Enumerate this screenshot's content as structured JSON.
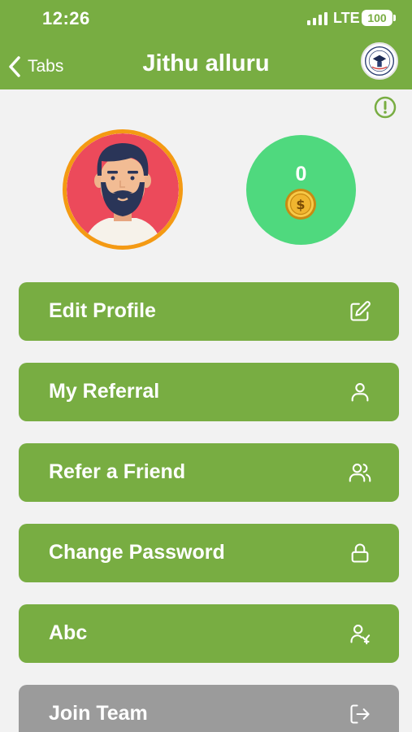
{
  "status_bar": {
    "time": "12:26",
    "network": "LTE",
    "battery": "100"
  },
  "nav": {
    "back_label": "Tabs",
    "title": "Jithu alluru"
  },
  "profile": {
    "coin_count": "0"
  },
  "menu": [
    {
      "label": "Edit Profile",
      "icon": "edit-icon"
    },
    {
      "label": "My Referral",
      "icon": "user-icon"
    },
    {
      "label": "Refer a Friend",
      "icon": "users-icon"
    },
    {
      "label": "Change Password",
      "icon": "lock-icon"
    },
    {
      "label": "Abc",
      "icon": "user-plus-icon"
    },
    {
      "label": "Join Team",
      "icon": "log-out-icon"
    }
  ],
  "colors": {
    "primary": "#78ad42",
    "coin_circle": "#4fd97e",
    "avatar_ring": "#f49a13",
    "disabled": "#9b9b9b"
  }
}
